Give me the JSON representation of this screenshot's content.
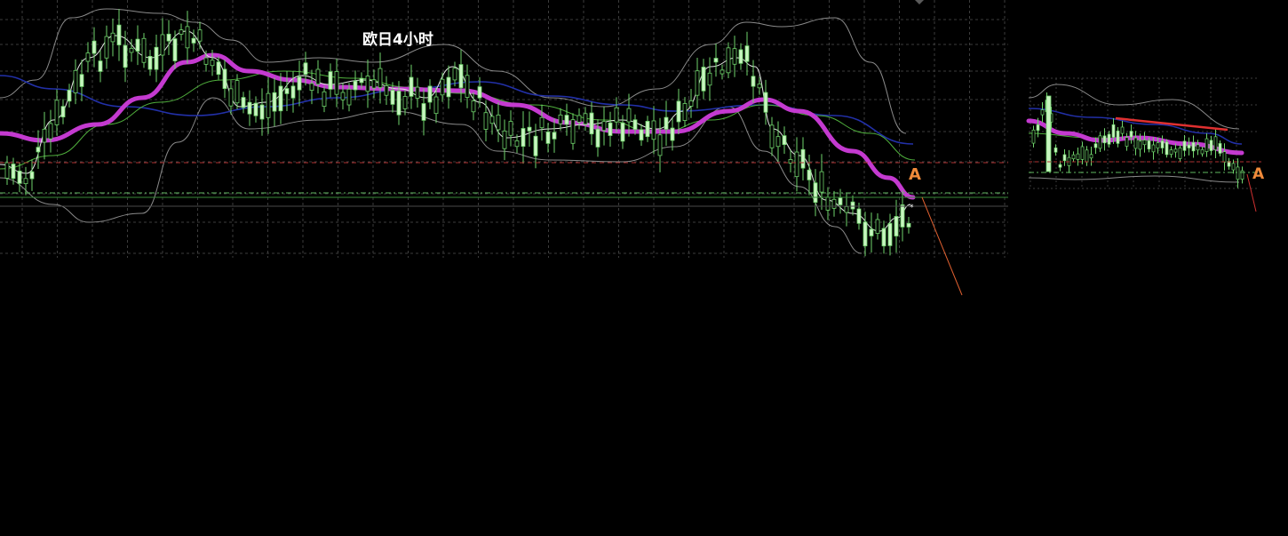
{
  "chart_data": [
    {
      "type": "candlestick",
      "title": "欧日4小时",
      "marker_label": "A",
      "colors": {
        "candle": "#c8f5c0",
        "candle_edge": "#6fd36b",
        "ema_thick": "#c43ad0",
        "ma_green": "#4fae3c",
        "ma_blue": "#2230a8",
        "bollinger": "#8a8a8a",
        "fast_ma": "#e6e6e6",
        "support_red": "#d03030",
        "support_green": "#5fb85f",
        "projection": "#e06030",
        "marker": "#f08a3a",
        "grid": "#3c3c3c"
      },
      "grid": true
    },
    {
      "type": "candlestick",
      "marker_label": "A",
      "colors": {
        "trendline": "#e03030",
        "projection": "#d03030",
        "marker": "#f08a3a"
      },
      "grid": true
    }
  ]
}
